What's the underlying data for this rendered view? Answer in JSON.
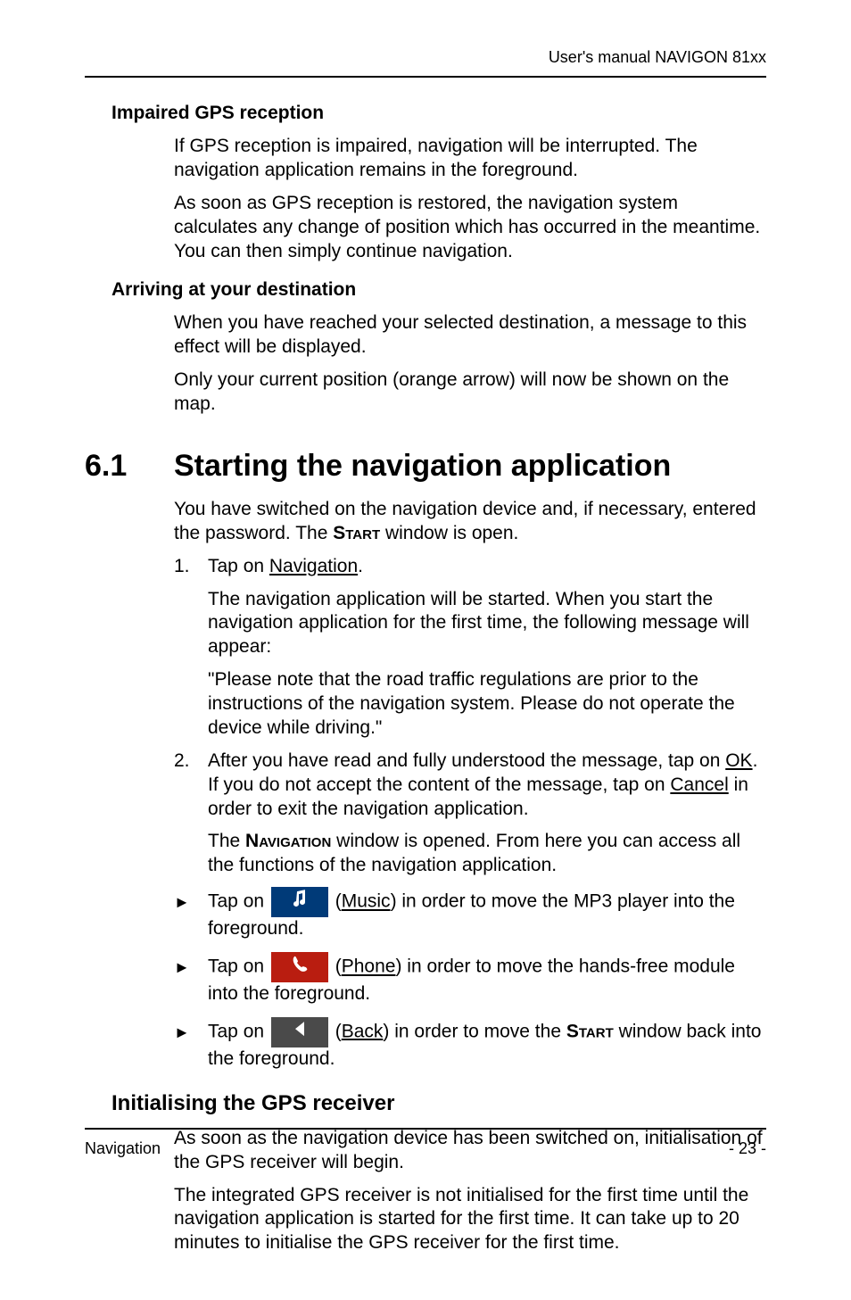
{
  "header": {
    "running": "User's manual NAVIGON 81xx"
  },
  "sec1": {
    "title": "Impaired GPS reception",
    "p1": "If GPS reception is impaired, navigation will be interrupted. The navigation application remains in the foreground.",
    "p2": "As soon as GPS reception is restored, the navigation system calculates any change of position which has occurred in the meantime. You can then simply continue navigation."
  },
  "sec2": {
    "title": "Arriving at your destination",
    "p1": "When you have reached your selected destination, a message to this effect will be displayed.",
    "p2": "Only your current position (orange arrow) will now be shown on the map."
  },
  "main": {
    "num": "6.1",
    "title": "Starting the navigation application",
    "intro1a": "You have switched on the navigation device and, if necessary, entered the password. The ",
    "intro1b_sc": "Start",
    "intro1c": " window is open.",
    "li1_pre": "Tap on ",
    "li1_link": "Navigation",
    "li1_post": ".",
    "li1_sub1": "The navigation application will be started. When you start the navigation application for the first time, the following message will appear:",
    "li1_sub2": "\"Please note that the road traffic regulations are prior to the instructions of the navigation system. Please do not operate the device while driving.\"",
    "li2_a": "After you have read and fully understood the message, tap on ",
    "li2_ok": "OK",
    "li2_b": ". If you do not accept the content of the message, tap on ",
    "li2_cancel": "Cancel",
    "li2_c": " in order to exit the navigation application.",
    "li2_sub_a": "The ",
    "li2_sub_sc": "Navigation",
    "li2_sub_b": " window is opened. From here you can access all the functions of the navigation application.",
    "b1_pre": "Tap on ",
    "b1_link": "Music",
    "b1_post": ") in order to move the MP3 player into the foreground.",
    "b2_pre": "Tap on ",
    "b2_link": "Phone",
    "b2_post": ") in order to move the hands-free module into the foreground.",
    "b3_pre": "Tap on ",
    "b3_link": "Back",
    "b3_post_a": ") in order to move the ",
    "b3_post_sc": "Start",
    "b3_post_b": " window back into the foreground."
  },
  "sec3": {
    "title": "Initialising the GPS receiver",
    "p1": "As soon as the navigation device has been switched on, initialisation of the GPS receiver will begin.",
    "p2": "The integrated GPS receiver is not initialised for the first time until the navigation application is started for the first time. It can take up to 20 minutes to initialise the GPS receiver for the first time."
  },
  "footer": {
    "left": "Navigation",
    "right": "- 23 -"
  },
  "list_nums": {
    "one": "1.",
    "two": "2."
  },
  "bullet_char": "►",
  "paren_open": " ("
}
